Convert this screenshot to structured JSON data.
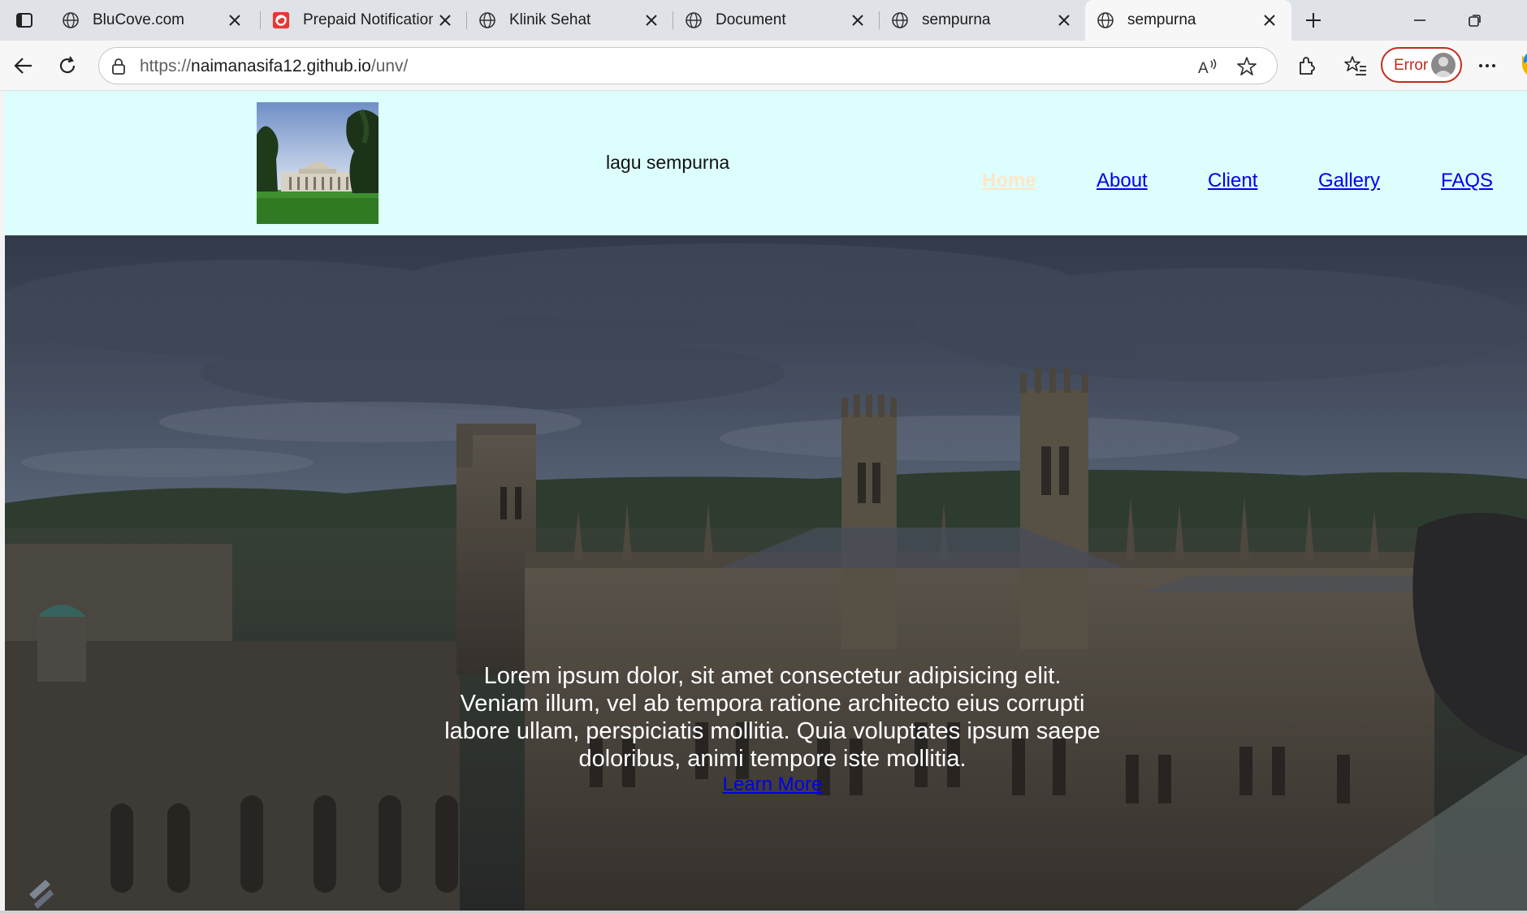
{
  "browser": {
    "tabs": [
      {
        "title": "BluCove.com",
        "icon": "globe-icon"
      },
      {
        "title": "Prepaid Notification",
        "icon": "prepaid-logo-icon"
      },
      {
        "title": "Klinik Sehat",
        "icon": "globe-icon"
      },
      {
        "title": "Document",
        "icon": "globe-icon"
      },
      {
        "title": "sempurna",
        "icon": "globe-icon"
      },
      {
        "title": "sempurna",
        "icon": "globe-icon",
        "active": true
      }
    ],
    "url_prefix": "https://",
    "url_host": "naimanasifa12.github.io",
    "url_path": "/unv/",
    "profile_status": "Error",
    "accent_error": "#c42b1c"
  },
  "site": {
    "title": "lagu sempurna",
    "nav": [
      "Home",
      "About",
      "Client",
      "Gallery",
      "FAQS"
    ],
    "hero_text": "Lorem ipsum dolor, sit amet consectetur adipisicing elit. Veniam illum, vel ab tempora ratione architecto eius corrupti labore ullam, perspiciatis mollitia. Quia voluptates ipsum saepe doloribus, animi tempore iste mollitia.",
    "hero_link": "Learn More",
    "header_bg": "#dcfefd",
    "home_link_color": "#ffe6c7"
  }
}
